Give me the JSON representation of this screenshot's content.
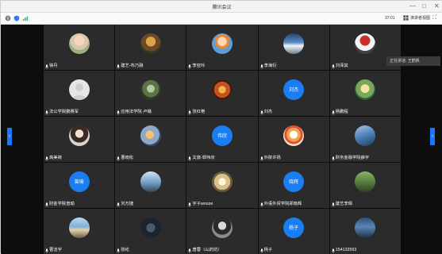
{
  "window": {
    "title": "腾讯会议",
    "controls": [
      "—",
      "□",
      "✕"
    ]
  },
  "toolbar": {
    "timer": "37:01",
    "view_label": "演讲者视图",
    "icons": [
      "info-icon",
      "shield-icon",
      "signal-icon",
      "gallery-view-icon",
      "fullscreen-icon"
    ]
  },
  "speaking": "正在讲话: 王鹤帆",
  "nav": {
    "prev": "‹",
    "next": "›"
  },
  "participants": [
    {
      "name": "徐丹",
      "avatar": "photo-portrait"
    },
    {
      "name": "建艺-布乃融",
      "avatar": "photo-outdoor"
    },
    {
      "name": "李亚玲",
      "avatar": "photo-cartoon"
    },
    {
      "name": "李海衍",
      "avatar": "photo-sky"
    },
    {
      "name": "刘泽其",
      "avatar": "photo-character"
    },
    {
      "name": "法公学院鹏赛军",
      "avatar": "default-gray"
    },
    {
      "name": "应用法学院 卢璐",
      "avatar": "photo-scene"
    },
    {
      "name": "张红艳",
      "avatar": "photo-sunset"
    },
    {
      "name": "刘杰",
      "avatar": "text",
      "avatar_text": "刘杰"
    },
    {
      "name": "杨鹏程",
      "avatar": "photo-nature"
    },
    {
      "name": "高美荷",
      "avatar": "photo-girl"
    },
    {
      "name": "曹晓松",
      "avatar": "photo-warm"
    },
    {
      "name": "文旅-郭伟欣",
      "avatar": "text",
      "avatar_text": "伟欣"
    },
    {
      "name": "外院许扬",
      "avatar": "photo-cartoon2"
    },
    {
      "name": "财务金融学院薛宇",
      "avatar": "photo-bird"
    },
    {
      "name": "财金学院曾瑜",
      "avatar": "text",
      "avatar_text": "曾瑜"
    },
    {
      "name": "刘万捷",
      "avatar": "photo-sky2"
    },
    {
      "name": "宇子wooze",
      "avatar": "photo-light"
    },
    {
      "name": "外语外贸学院郑晓辉",
      "avatar": "text",
      "avatar_text": "晓辉"
    },
    {
      "name": "建艺李佩",
      "avatar": "photo-road"
    },
    {
      "name": "曹洁宇",
      "avatar": "photo-beach"
    },
    {
      "name": "张屹",
      "avatar": "photo-dark"
    },
    {
      "name": "唐蓉（山药坊）",
      "avatar": "photo-bw"
    },
    {
      "name": "杨子",
      "avatar": "text",
      "avatar_text": "杨子"
    },
    {
      "name": "154133593",
      "avatar": "photo-city"
    }
  ]
}
